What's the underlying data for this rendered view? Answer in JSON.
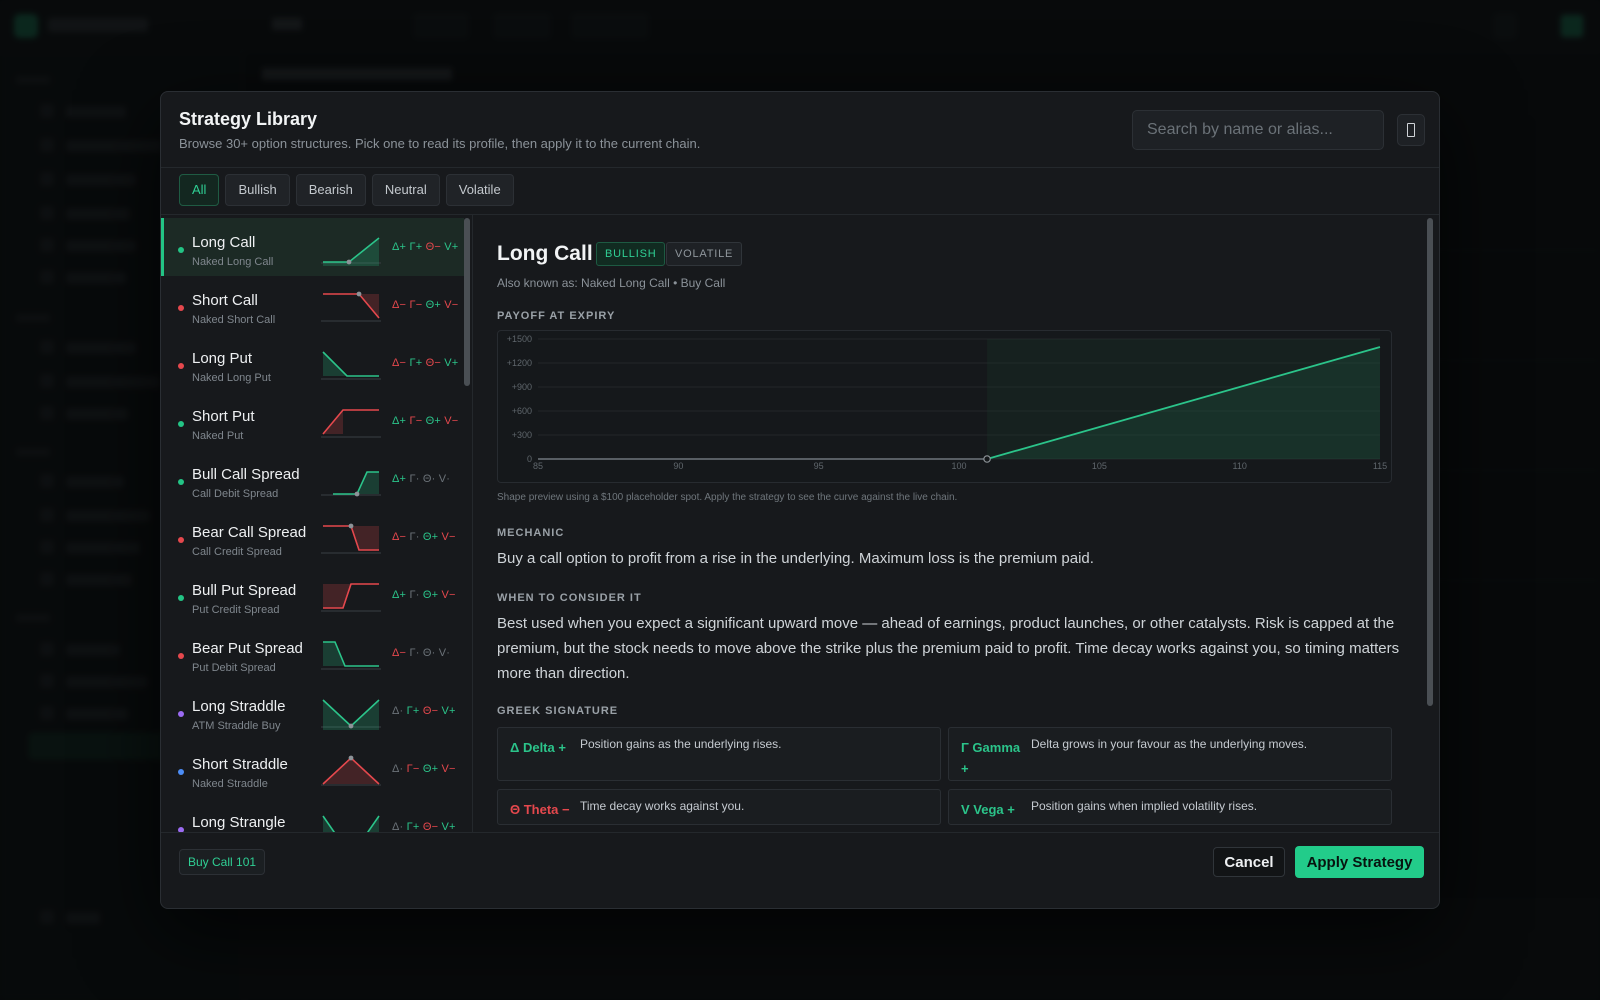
{
  "modal": {
    "title": "Strategy Library",
    "subtitle": "Browse 30+ option structures. Pick one to read its profile, then apply it to the current chain.",
    "search_placeholder": "Search by name or alias...",
    "filters": [
      "All",
      "Bullish",
      "Bearish",
      "Neutral",
      "Volatile"
    ],
    "active_filter": "All"
  },
  "strategies": [
    {
      "name": "Long Call",
      "alias": "Naked Long Call",
      "bias": "bullish",
      "shape": "long-call",
      "greeks": [
        [
          "Δ+",
          "pos"
        ],
        [
          "Γ+",
          "pos"
        ],
        [
          "Θ−",
          "neg"
        ],
        [
          "V+",
          "pos"
        ]
      ],
      "selected": true
    },
    {
      "name": "Short Call",
      "alias": "Naked Short Call",
      "bias": "bearish",
      "shape": "short-call",
      "greeks": [
        [
          "Δ−",
          "neg"
        ],
        [
          "Γ−",
          "neg"
        ],
        [
          "Θ+",
          "pos"
        ],
        [
          "V−",
          "neg"
        ]
      ]
    },
    {
      "name": "Long Put",
      "alias": "Naked Long Put",
      "bias": "bearish",
      "shape": "long-put",
      "greeks": [
        [
          "Δ−",
          "neg"
        ],
        [
          "Γ+",
          "pos"
        ],
        [
          "Θ−",
          "neg"
        ],
        [
          "V+",
          "pos"
        ]
      ]
    },
    {
      "name": "Short Put",
      "alias": "Naked Put",
      "bias": "bullish",
      "shape": "short-put",
      "greeks": [
        [
          "Δ+",
          "pos"
        ],
        [
          "Γ−",
          "neg"
        ],
        [
          "Θ+",
          "pos"
        ],
        [
          "V−",
          "neg"
        ]
      ]
    },
    {
      "name": "Bull Call Spread",
      "alias": "Call Debit Spread",
      "bias": "bullish",
      "shape": "bull-call",
      "greeks": [
        [
          "Δ+",
          "pos"
        ],
        [
          "Γ·",
          "dim"
        ],
        [
          "Θ·",
          "dim"
        ],
        [
          "V·",
          "dim"
        ]
      ]
    },
    {
      "name": "Bear Call Spread",
      "alias": "Call Credit Spread",
      "bias": "bearish",
      "shape": "bear-call",
      "greeks": [
        [
          "Δ−",
          "neg"
        ],
        [
          "Γ·",
          "dim"
        ],
        [
          "Θ+",
          "pos"
        ],
        [
          "V−",
          "neg"
        ]
      ]
    },
    {
      "name": "Bull Put Spread",
      "alias": "Put Credit Spread",
      "bias": "bullish",
      "shape": "bull-put",
      "greeks": [
        [
          "Δ+",
          "pos"
        ],
        [
          "Γ·",
          "dim"
        ],
        [
          "Θ+",
          "pos"
        ],
        [
          "V−",
          "neg"
        ]
      ]
    },
    {
      "name": "Bear Put Spread",
      "alias": "Put Debit Spread",
      "bias": "bearish",
      "shape": "bear-put",
      "greeks": [
        [
          "Δ−",
          "neg"
        ],
        [
          "Γ·",
          "dim"
        ],
        [
          "Θ·",
          "dim"
        ],
        [
          "V·",
          "dim"
        ]
      ]
    },
    {
      "name": "Long Straddle",
      "alias": "ATM Straddle Buy",
      "bias": "volatile",
      "shape": "long-straddle",
      "greeks": [
        [
          "Δ·",
          "dim"
        ],
        [
          "Γ+",
          "pos"
        ],
        [
          "Θ−",
          "neg"
        ],
        [
          "V+",
          "pos"
        ]
      ]
    },
    {
      "name": "Short Straddle",
      "alias": "Naked Straddle",
      "bias": "neutral",
      "shape": "short-straddle",
      "greeks": [
        [
          "Δ·",
          "dim"
        ],
        [
          "Γ−",
          "neg"
        ],
        [
          "Θ+",
          "pos"
        ],
        [
          "V−",
          "neg"
        ]
      ]
    },
    {
      "name": "Long Strangle",
      "alias": "",
      "bias": "volatile",
      "shape": "long-strangle",
      "greeks": [
        [
          "Δ·",
          "dim"
        ],
        [
          "Γ+",
          "pos"
        ],
        [
          "Θ−",
          "neg"
        ],
        [
          "V+",
          "pos"
        ]
      ]
    }
  ],
  "detail": {
    "title": "Long Call",
    "tags": [
      "BULLISH",
      "VOLATILE"
    ],
    "alias_line": "Also known as: Naked Long Call • Buy Call",
    "payoff_heading": "PAYOFF AT EXPIRY",
    "chart_note": "Shape preview using a $100 placeholder spot. Apply the strategy to see the curve against the live chain.",
    "mechanic_heading": "MECHANIC",
    "mechanic_text": "Buy a call option to profit from a rise in the underlying. Maximum loss is the premium paid.",
    "when_heading": "WHEN TO CONSIDER IT",
    "when_text": "Best used when you expect a significant upward move — ahead of earnings, product launches, or other catalysts. Risk is capped at the premium, but the stock needs to move above the strike plus the premium paid to profit. Time decay works against you, so timing matters more than direction.",
    "greek_heading": "GREEK SIGNATURE",
    "greek_cards": [
      {
        "name": "Δ Delta +",
        "desc": "Position gains as the underlying rises.",
        "tone": "pos"
      },
      {
        "name": "Γ Gamma +",
        "desc": "Delta grows in your favour as the underlying moves.",
        "tone": "pos"
      },
      {
        "name": "Θ Theta −",
        "desc": "Time decay works against you.",
        "tone": "neg"
      },
      {
        "name": "V Vega +",
        "desc": "Position gains when implied volatility rises.",
        "tone": "pos"
      }
    ]
  },
  "chart_data": {
    "type": "line",
    "title": "",
    "x": [
      85,
      101,
      115
    ],
    "y": [
      0,
      0,
      1400
    ],
    "xticks": [
      85,
      90,
      95,
      100,
      105,
      110,
      115
    ],
    "yticks": [
      "0",
      "+300",
      "+600",
      "+900",
      "+1200",
      "+1500"
    ],
    "ytick_values": [
      0,
      300,
      600,
      900,
      1200,
      1500
    ],
    "xlim": [
      85,
      115
    ],
    "ylim": [
      0,
      1500
    ],
    "strike": 101,
    "grid": true
  },
  "footer": {
    "tag": "Buy Call 101",
    "cancel_label": "Cancel",
    "apply_label": "Apply Strategy"
  },
  "colors": {
    "accent": "#22cc8a",
    "positive": "#2bc48a",
    "negative": "#e5484d",
    "bullish_dot": "#23c485",
    "bearish_dot": "#e5484d",
    "volatile_dot": "#9b6bf2",
    "neutral_dot": "#4c8df6"
  }
}
